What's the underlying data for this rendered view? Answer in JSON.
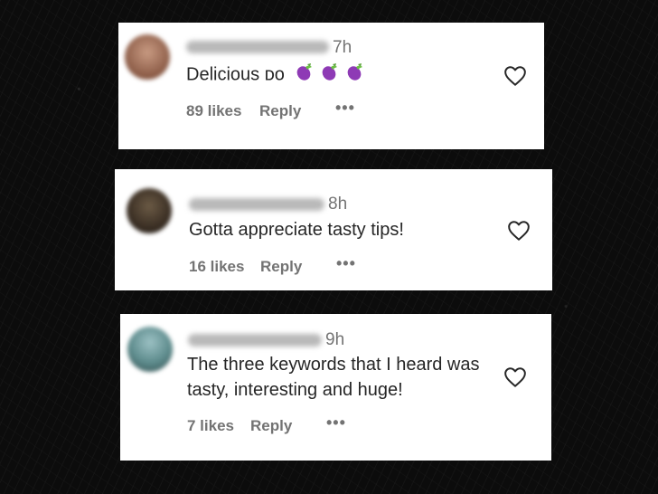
{
  "comments": [
    {
      "time": "7h",
      "text": "Delicious ᴅᴏ",
      "emoji": [
        "eggplant-icon",
        "eggplant-icon",
        "eggplant-icon"
      ],
      "likes": "89 likes",
      "reply": "Reply",
      "more": "•••"
    },
    {
      "time": "8h",
      "text": "Gotta appreciate tasty tips!",
      "likes": "16 likes",
      "reply": "Reply",
      "more": "•••"
    },
    {
      "time": "9h",
      "text": "The three keywords that I heard was tasty, interesting and huge!",
      "likes": "7 likes",
      "reply": "Reply",
      "more": "•••"
    }
  ],
  "colors": {
    "card_bg": "#ffffff",
    "text": "#262626",
    "muted": "#737373",
    "eggplant": "#8e3ab5"
  }
}
